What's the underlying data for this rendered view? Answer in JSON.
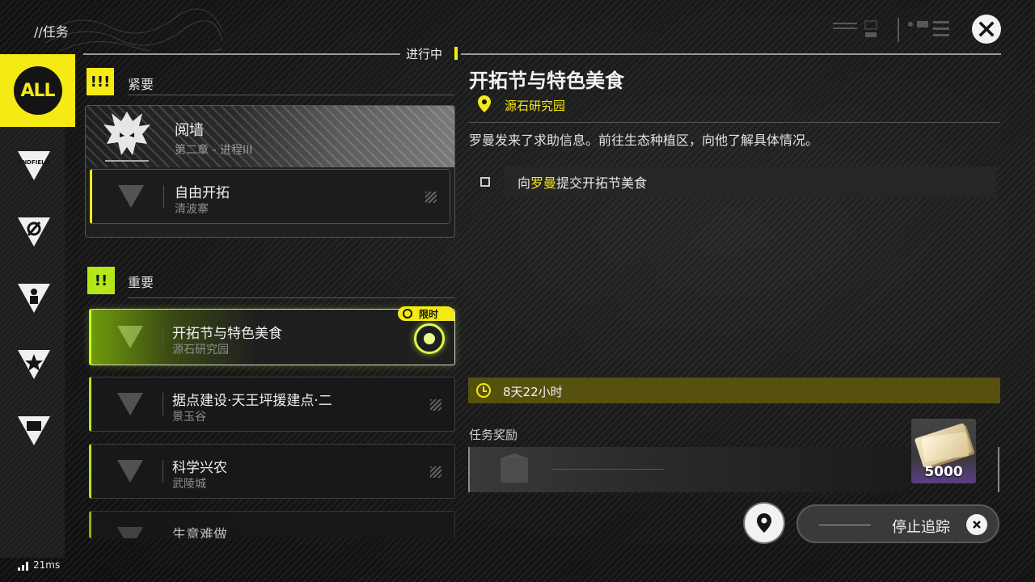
{
  "header": {
    "title": "//任务",
    "progress_label": "进行中"
  },
  "sidebar": {
    "all_label": "ALL",
    "items": [
      {
        "icon": "endfield-icon"
      },
      {
        "icon": "exploration-icon"
      },
      {
        "icon": "person-icon"
      },
      {
        "icon": "star-icon"
      },
      {
        "icon": "building-icon"
      }
    ]
  },
  "sections": {
    "urgent": {
      "badge": "!!!",
      "title": "紧要"
    },
    "important": {
      "badge": "!!",
      "title": "重要"
    }
  },
  "urgent_card": {
    "title": "阅墙",
    "subtitle": "第二章 - 进程III",
    "sub_item": {
      "title": "自由开拓",
      "subtitle": "清波寨"
    }
  },
  "quests": [
    {
      "title": "开拓节与特色美食",
      "subtitle": "源石研究园",
      "selected": true
    },
    {
      "title": "据点建设·天王坪援建点·二",
      "subtitle": "景玉谷"
    },
    {
      "title": "科学兴农",
      "subtitle": "武陵城"
    },
    {
      "title": "生意难做",
      "subtitle": ""
    }
  ],
  "limited_tag": "限时",
  "detail": {
    "title": "开拓节与特色美食",
    "location": "源石研究园",
    "description": "罗曼发来了求助信息。前往生态种植区，向他了解具体情况。",
    "objective_prefix": "向",
    "objective_highlight": "罗曼",
    "objective_suffix": "提交开拓节美食",
    "timer": "8天22小时",
    "reward_label": "任务奖励",
    "reward_qty": "5000"
  },
  "actions": {
    "stop_tracking": "停止追踪"
  },
  "status": {
    "latency": "21ms"
  },
  "colors": {
    "accent_yellow": "#f5ea14",
    "accent_green": "#b4e61a",
    "timer_bg": "#57510f"
  }
}
